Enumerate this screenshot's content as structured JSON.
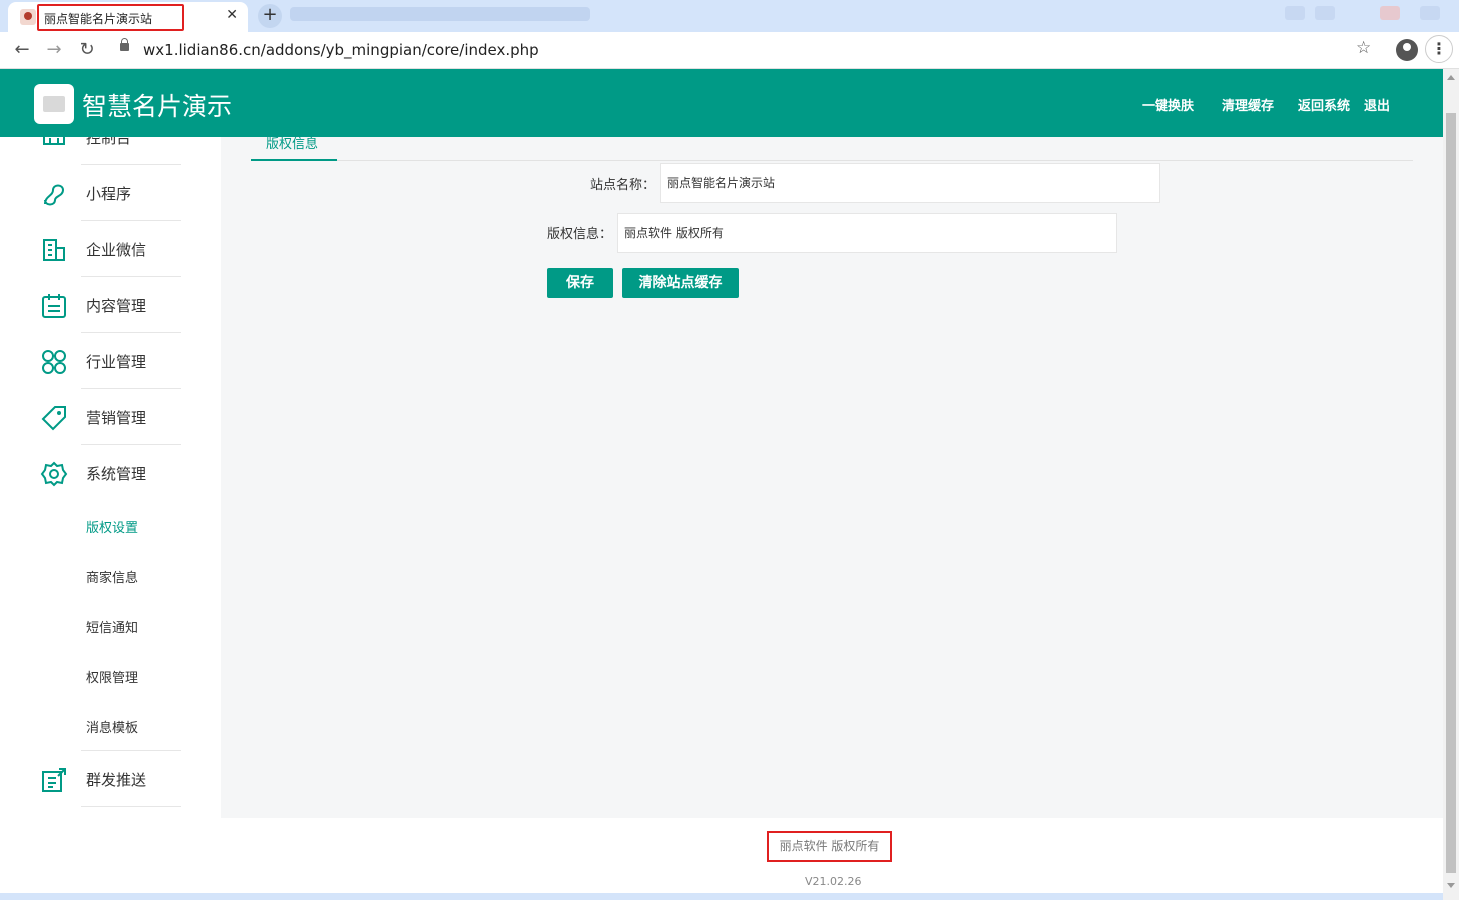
{
  "browser": {
    "tab_title": "丽点智能名片演示站",
    "tab_close": "✕",
    "new_tab": "+",
    "url": "wx1.lidian86.cn/addons/yb_mingpian/core/index.php"
  },
  "header": {
    "app_title": "智慧名片演示",
    "links": [
      "一键换肤",
      "清理缓存",
      "返回系统",
      "退出"
    ]
  },
  "sidebar": {
    "items": [
      {
        "label": "控制台",
        "icon": "dashboard-icon"
      },
      {
        "label": "小程序",
        "icon": "miniprogram-icon"
      },
      {
        "label": "企业微信",
        "icon": "building-icon"
      },
      {
        "label": "内容管理",
        "icon": "calendar-icon"
      },
      {
        "label": "行业管理",
        "icon": "clover-icon"
      },
      {
        "label": "营销管理",
        "icon": "tag-icon"
      },
      {
        "label": "系统管理",
        "icon": "gear-icon"
      }
    ],
    "sub_items": [
      "版权设置",
      "商家信息",
      "短信通知",
      "权限管理",
      "消息模板"
    ],
    "active_sub": "版权设置",
    "last_item": {
      "label": "群发推送",
      "icon": "broadcast-icon"
    }
  },
  "main": {
    "tab": "版权信息",
    "form": {
      "site_name_label": "站点名称：",
      "site_name_value": "丽点智能名片演示站",
      "copyright_label": "版权信息：",
      "copyright_value": "丽点软件 版权所有"
    },
    "buttons": {
      "save": "保存",
      "clear_cache": "清除站点缓存"
    }
  },
  "footer": {
    "copyright": "丽点软件 版权所有",
    "version": "V21.02.26"
  },
  "colors": {
    "primary": "#009a86",
    "highlight_box": "#e02020"
  }
}
